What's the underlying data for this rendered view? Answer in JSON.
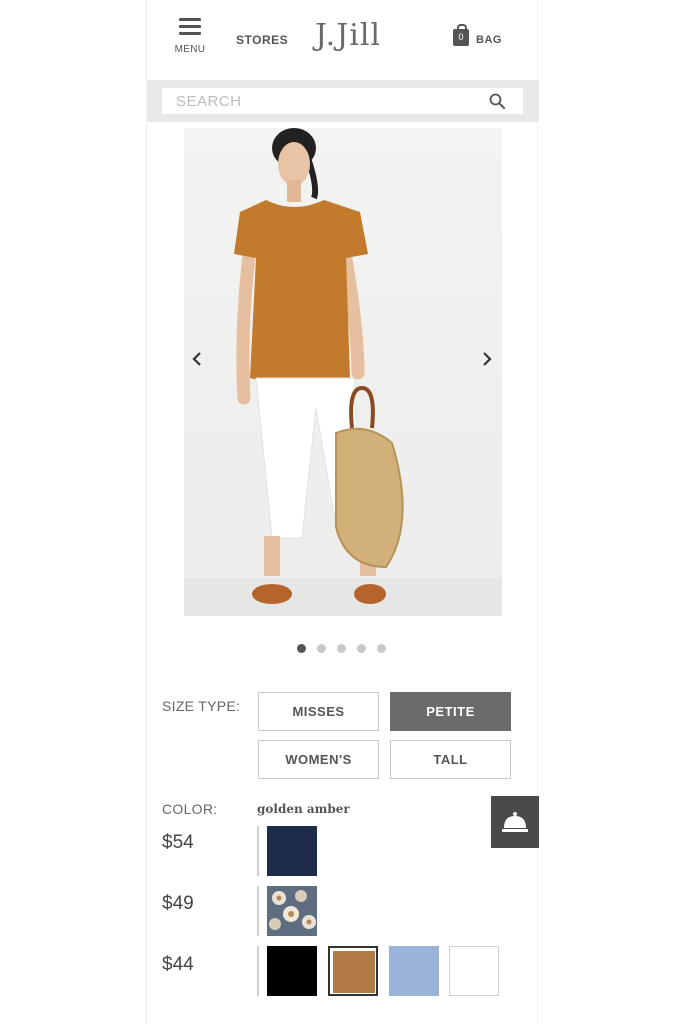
{
  "header": {
    "menu_label": "MENU",
    "stores_label": "STORES",
    "logo_text": "J.Jill",
    "bag_count": "0",
    "bag_label": "BAG"
  },
  "search": {
    "placeholder": "SEARCH"
  },
  "carousel": {
    "slide_count": 5,
    "active_index": 0
  },
  "size_type": {
    "label": "SIZE TYPE:",
    "options": [
      "MISSES",
      "PETITE",
      "WOMEN'S",
      "TALL"
    ],
    "selected": "PETITE"
  },
  "color": {
    "label": "COLOR:",
    "selected_name": "golden amber",
    "groups": [
      {
        "price": "$54",
        "swatches": [
          {
            "color": "#1e2c4a",
            "name": "navy"
          }
        ]
      },
      {
        "price": "$49",
        "swatches": [
          {
            "color": "#6f7e8e",
            "name": "floral print"
          }
        ]
      },
      {
        "price": "$44",
        "swatches": [
          {
            "color": "#000000",
            "name": "black"
          },
          {
            "color": "#b07b44",
            "name": "golden amber",
            "selected": true
          },
          {
            "color": "#9ab3d9",
            "name": "light blue"
          },
          {
            "color": "#ffffff",
            "name": "white"
          }
        ]
      }
    ]
  },
  "colors": {
    "selected_size_bg": "#6b6b6b",
    "search_bar_bg": "#e8e8e8",
    "concierge_bg": "#4a4a4a"
  }
}
